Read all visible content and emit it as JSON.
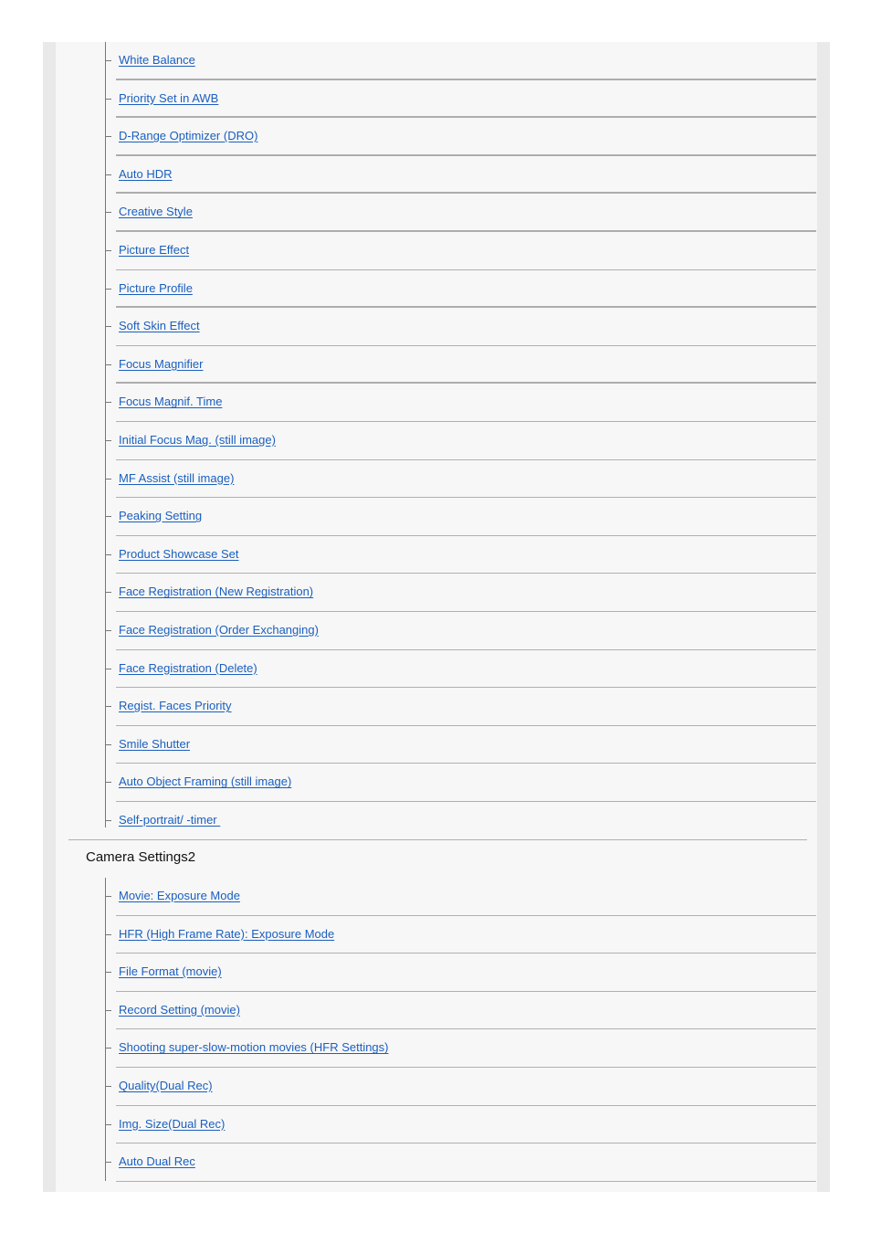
{
  "colors": {
    "link": "#1a5fbf",
    "frame": "#e9e9e9",
    "panel": "#f7f7f7",
    "divider": "#b0b0b0",
    "tree_line": "#777777"
  },
  "section1": {
    "items": [
      {
        "label": "White Balance"
      },
      {
        "label": "Priority Set in AWB"
      },
      {
        "label": "D-Range Optimizer (DRO)"
      },
      {
        "label": "Auto HDR"
      },
      {
        "label": "Creative Style"
      },
      {
        "label": "Picture Effect"
      },
      {
        "label": "Picture Profile"
      },
      {
        "label": "Soft Skin Effect"
      },
      {
        "label": "Focus Magnifier"
      },
      {
        "label": "Focus Magnif. Time"
      },
      {
        "label": "Initial Focus Mag. (still image)"
      },
      {
        "label": "MF Assist (still image)"
      },
      {
        "label": "Peaking Setting"
      },
      {
        "label": "Product Showcase Set"
      },
      {
        "label": "Face Registration (New Registration)"
      },
      {
        "label": "Face Registration (Order Exchanging)"
      },
      {
        "label": "Face Registration (Delete)"
      },
      {
        "label": "Regist. Faces Priority"
      },
      {
        "label": "Smile Shutter"
      },
      {
        "label": "Auto Object Framing (still image)"
      },
      {
        "label": "Self-portrait/ -timer "
      }
    ]
  },
  "section2": {
    "heading": "Camera Settings2",
    "items": [
      {
        "label": "Movie: Exposure Mode"
      },
      {
        "label": "HFR (High Frame Rate): Exposure Mode"
      },
      {
        "label": "File Format (movie)"
      },
      {
        "label": "Record Setting (movie)"
      },
      {
        "label": "Shooting super-slow-motion movies (HFR Settings)"
      },
      {
        "label": "Quality(Dual Rec)"
      },
      {
        "label": "Img. Size(Dual Rec)"
      },
      {
        "label": "Auto Dual Rec"
      }
    ]
  }
}
